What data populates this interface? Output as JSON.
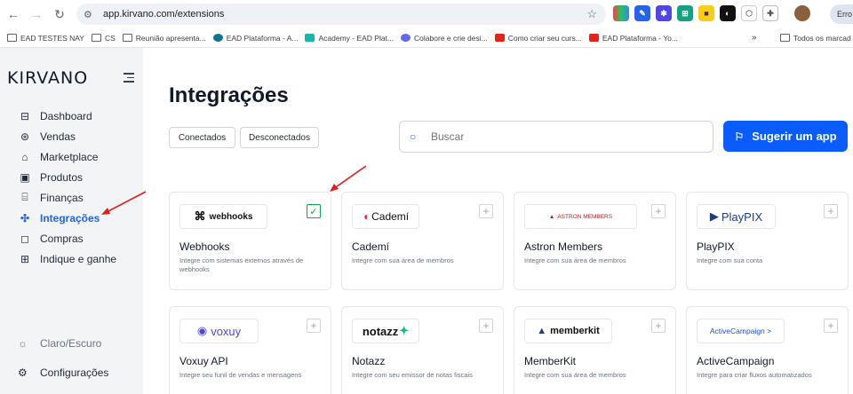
{
  "browser": {
    "url": "app.kirvano.com/extensions",
    "profile_label": "Erro",
    "bookmarks": [
      "EAD TESTES NAY",
      "CS",
      "Reunião apresenta...",
      "EAD Plataforma - A...",
      "Academy - EAD Plat...",
      "Colabore e crie desi...",
      "Como criar seu curs...",
      "EAD Plataforma - Yo..."
    ],
    "bookmarks_more": "»",
    "bookmarks_last": "Todos os marcad"
  },
  "sidebar": {
    "logo": "KIRVANO",
    "items": [
      {
        "label": "Dashboard",
        "icon": "dashboard-icon"
      },
      {
        "label": "Vendas",
        "icon": "dollar-icon"
      },
      {
        "label": "Marketplace",
        "icon": "store-icon"
      },
      {
        "label": "Produtos",
        "icon": "box-icon"
      },
      {
        "label": "Finanças",
        "icon": "bank-icon"
      },
      {
        "label": "Integrações",
        "icon": "puzzle-icon",
        "active": true
      },
      {
        "label": "Compras",
        "icon": "bag-icon"
      },
      {
        "label": "Indique e ganhe",
        "icon": "gift-icon"
      }
    ],
    "theme_label": "Claro/Escuro",
    "config_label": "Configurações"
  },
  "main": {
    "title": "Integrações",
    "filters": [
      "Conectados",
      "Desconectados"
    ],
    "search_placeholder": "Buscar",
    "suggest_label": "Sugerir um app"
  },
  "cards": [
    {
      "name": "Webhooks",
      "logo": "webhooks",
      "desc": "Integre com sistemas externos através de webhooks",
      "checked": true
    },
    {
      "name": "Cademí",
      "logo": "Cademí",
      "desc": "Integre com sua área de membros",
      "checked": false
    },
    {
      "name": "Astron Members",
      "logo": "ASTRON MEMBERS",
      "desc": "Integre com sua área de membros",
      "checked": false
    },
    {
      "name": "PlayPIX",
      "logo": "PlayPIX",
      "desc": "Integre com sua conta",
      "checked": false
    },
    {
      "name": "Voxuy API",
      "logo": "voxuy",
      "desc": "Integre seu funil de vendas e mensagens",
      "checked": false
    },
    {
      "name": "Notazz",
      "logo": "notazz",
      "desc": "Integre com seu emissor de notas fiscais",
      "checked": false
    },
    {
      "name": "MemberKit",
      "logo": "memberkit",
      "desc": "Integre com sua área de membros",
      "checked": false
    },
    {
      "name": "ActiveCampaign",
      "logo": "ActiveCampaign >",
      "desc": "Integre para criar fluxos automatizados",
      "checked": false
    }
  ],
  "colors": {
    "accent": "#0b5cff",
    "active_nav": "#2563eb",
    "annotation_arrow": "#e11d1d",
    "check": "#16a34a"
  }
}
